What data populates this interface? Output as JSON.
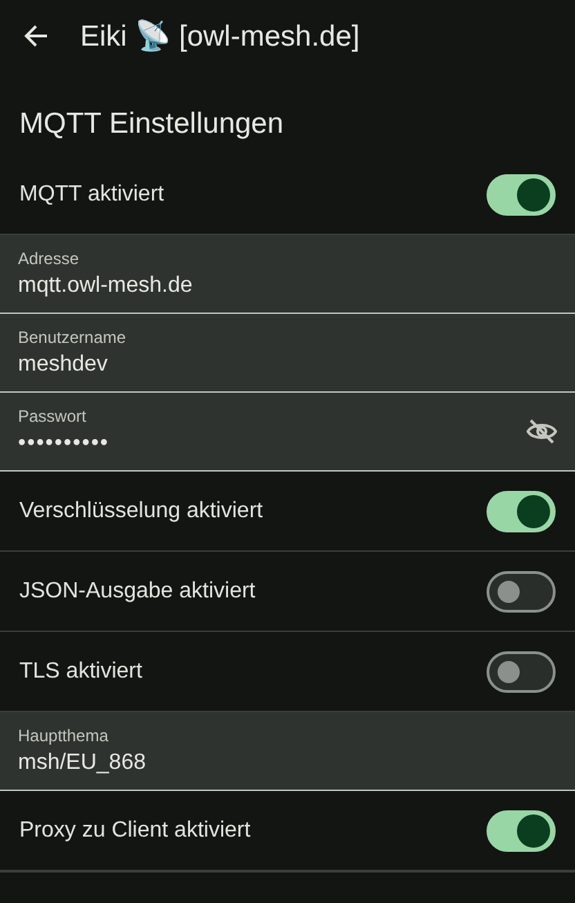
{
  "app_bar": {
    "title": "Eiki 📡 [owl-mesh.de]"
  },
  "section_title": "MQTT Einstellungen",
  "items": [
    {
      "kind": "switch",
      "label": "MQTT aktiviert",
      "on": true
    },
    {
      "kind": "field",
      "label": "Adresse",
      "value": "mqtt.owl-mesh.de"
    },
    {
      "kind": "field",
      "label": "Benutzername",
      "value": "meshdev"
    },
    {
      "kind": "password",
      "label": "Passwort",
      "value": "••••••••••"
    },
    {
      "kind": "switch",
      "label": "Verschlüsselung aktiviert",
      "on": true
    },
    {
      "kind": "switch",
      "label": "JSON-Ausgabe aktiviert",
      "on": false
    },
    {
      "kind": "switch",
      "label": "TLS aktiviert",
      "on": false
    },
    {
      "kind": "field",
      "label": "Hauptthema",
      "value": "msh/EU_868"
    },
    {
      "kind": "switch",
      "label": "Proxy zu Client aktiviert",
      "on": true
    }
  ]
}
